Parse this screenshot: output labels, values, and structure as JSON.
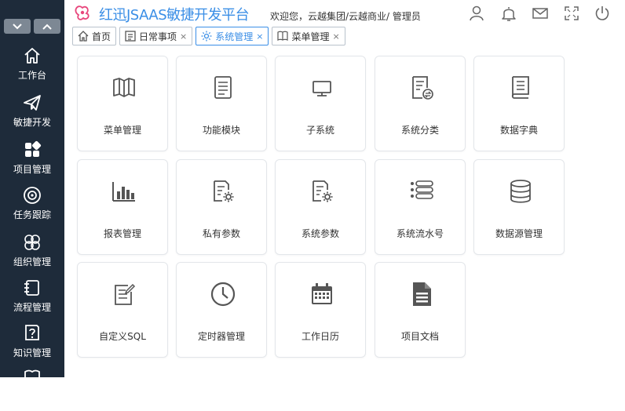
{
  "app": {
    "title": "红迅JSAAS敏捷开发平台",
    "welcome": "欢迎您，云越集团/云越商业/ 管理员"
  },
  "colors": {
    "accent": "#3a8ee6",
    "sidebar": "#1e2b3a",
    "logo": "#e8467c",
    "icon": "#555555"
  },
  "header_icons": [
    "user-icon",
    "bell-icon",
    "mail-icon",
    "fullscreen-icon",
    "power-icon"
  ],
  "sidebar": {
    "items": [
      {
        "label": "工作台",
        "icon": "home-icon"
      },
      {
        "label": "敏捷开发",
        "icon": "paper-plane-icon"
      },
      {
        "label": "项目管理",
        "icon": "grid-icon"
      },
      {
        "label": "任务跟踪",
        "icon": "target-icon"
      },
      {
        "label": "组织管理",
        "icon": "circles-icon"
      },
      {
        "label": "流程管理",
        "icon": "flow-doc-icon"
      },
      {
        "label": "知识管理",
        "icon": "question-doc-icon"
      }
    ]
  },
  "tabs": [
    {
      "label": "首页",
      "icon": "home-icon",
      "closable": false
    },
    {
      "label": "日常事项",
      "icon": "list-icon",
      "closable": true
    },
    {
      "label": "系统管理",
      "icon": "gear-icon",
      "closable": true,
      "active": true
    },
    {
      "label": "菜单管理",
      "icon": "book-icon",
      "closable": true
    }
  ],
  "close_glyph": "×",
  "modules": [
    {
      "label": "菜单管理",
      "icon": "open-book-icon"
    },
    {
      "label": "功能模块",
      "icon": "document-icon"
    },
    {
      "label": "子系统",
      "icon": "monitor-icon"
    },
    {
      "label": "系统分类",
      "icon": "doc-swap-icon"
    },
    {
      "label": "数据字典",
      "icon": "dictionary-icon"
    },
    {
      "label": "报表管理",
      "icon": "bar-chart-icon"
    },
    {
      "label": "私有参数",
      "icon": "doc-gear-icon"
    },
    {
      "label": "系统参数",
      "icon": "doc-gear-icon"
    },
    {
      "label": "系统流水号",
      "icon": "list-lines-icon"
    },
    {
      "label": "数据源管理",
      "icon": "database-icon"
    },
    {
      "label": "自定义SQL",
      "icon": "edit-doc-icon"
    },
    {
      "label": "定时器管理",
      "icon": "clock-icon"
    },
    {
      "label": "工作日历",
      "icon": "calendar-icon"
    },
    {
      "label": "项目文档",
      "icon": "file-text-icon"
    }
  ]
}
